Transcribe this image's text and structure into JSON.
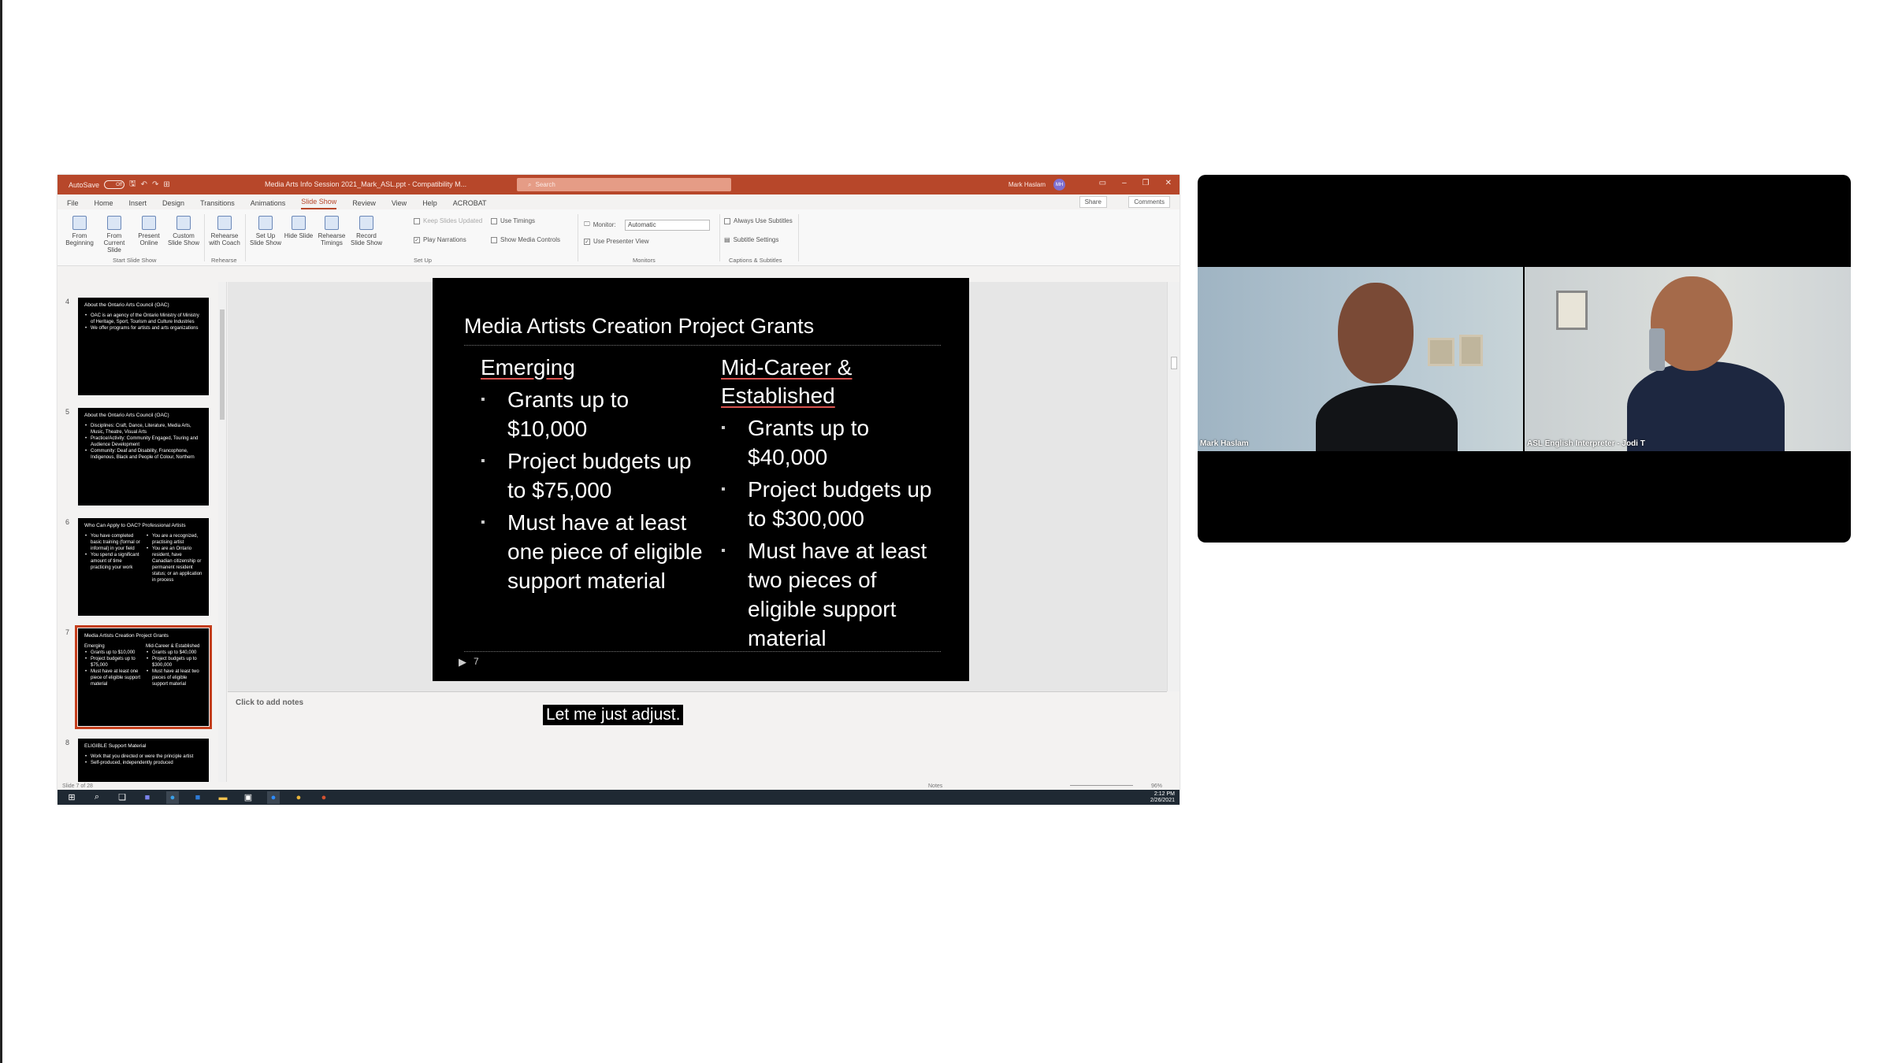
{
  "powerpoint": {
    "titlebar": {
      "autosave_label": "AutoSave",
      "autosave_state": "Off",
      "document_title": "Media Arts Info Session 2021_Mark_ASL.ppt - Compatibility M...",
      "search_placeholder": "Search",
      "user_name": "Mark Haslam",
      "user_initials": "MH",
      "accent_color": "#b7472a"
    },
    "tabs": [
      "File",
      "Home",
      "Insert",
      "Design",
      "Transitions",
      "Animations",
      "Slide Show",
      "Review",
      "View",
      "Help",
      "ACROBAT"
    ],
    "active_tab": "Slide Show",
    "share_label": "Share",
    "comments_label": "Comments",
    "ribbon": {
      "start_group": {
        "label": "Start Slide Show",
        "buttons": [
          "From Beginning",
          "From Current Slide",
          "Present Online",
          "Custom Slide Show"
        ]
      },
      "rehearse_group": {
        "label": "Rehearse",
        "buttons": [
          "Rehearse with Coach"
        ]
      },
      "setup_group": {
        "label": "Set Up",
        "buttons": [
          "Set Up Slide Show",
          "Hide Slide",
          "Rehearse Timings",
          "Record Slide Show"
        ],
        "checks": [
          "Keep Slides Updated",
          "Play Narrations",
          "Use Timings",
          "Show Media Controls"
        ]
      },
      "monitors_group": {
        "label": "Monitors",
        "monitor_label": "Monitor:",
        "monitor_value": "Automatic",
        "presenter_view": "Use Presenter View"
      },
      "captions_group": {
        "label": "Captions & Subtitles",
        "always_use_subtitles": "Always Use Subtitles",
        "subtitle_settings": "Subtitle Settings"
      }
    },
    "thumbnails": [
      {
        "number": "4",
        "title": "About the Ontario Arts Council (OAC)",
        "bullets": [
          "OAC is an agency of the Ontario Ministry of Ministry of Heritage, Sport, Tourism and Culture Industries",
          "We offer programs for artists and arts organizations"
        ]
      },
      {
        "number": "5",
        "title": "About the Ontario Arts Council (OAC)",
        "bullets": [
          "Disciplines: Craft, Dance, Literature, Media Arts, Music, Theatre, Visual Arts",
          "Practice/Activity: Community Engaged, Touring and Audience Development",
          "Community: Deaf and Disability, Francophone, Indigenous, Black and People of Colour, Northern"
        ]
      },
      {
        "number": "6",
        "title": "Who Can Apply to OAC? Professional Artists",
        "left": [
          "You have completed basic training (formal or informal) in your field",
          "You spend a significant amount of time practicing your work"
        ],
        "right": [
          "You are a recognized, practising artist",
          "You are an Ontario resident, have Canadian citizenship or permanent resident status; or an application in process"
        ]
      },
      {
        "number": "7",
        "title": "Media Artists Creation Project Grants",
        "left_head": "Emerging",
        "left": [
          "Grants up to $10,000",
          "Project budgets up to $75,000",
          "Must have at least one piece of eligible support material"
        ],
        "right_head": "Mid-Career & Established",
        "right": [
          "Grants up to $40,000",
          "Project budgets up to $300,000",
          "Must have at least two pieces of eligible support material"
        ]
      },
      {
        "number": "8",
        "title": "ELIGIBLE Support Material",
        "bullets": [
          "Work that you directed or were the principle artist",
          "Self-produced, independently produced"
        ]
      }
    ],
    "slide": {
      "title": "Media Artists Creation Project Grants",
      "left_heading": "Emerging",
      "left_bullets": [
        "Grants up to $10,000",
        "Project budgets up to $75,000",
        "Must have at least one piece of eligible support material"
      ],
      "right_heading": "Mid-Career & Established",
      "right_bullets": [
        "Grants up to $40,000",
        "Project budgets up to $300,000",
        "Must have at least two pieces of eligible support material"
      ],
      "slide_number": "7"
    },
    "notes_placeholder": "Click to add notes",
    "status": {
      "slide_position": "Slide 7 of 28",
      "notes_label": "Notes",
      "zoom": "96%"
    },
    "taskbar": {
      "time": "2:12 PM",
      "date": "2/26/2021"
    }
  },
  "caption_text": "Let me just adjust.",
  "video": {
    "participants": [
      {
        "name": "Mark Haslam"
      },
      {
        "name": "ASL English Interpreter - Jodi T"
      }
    ]
  }
}
